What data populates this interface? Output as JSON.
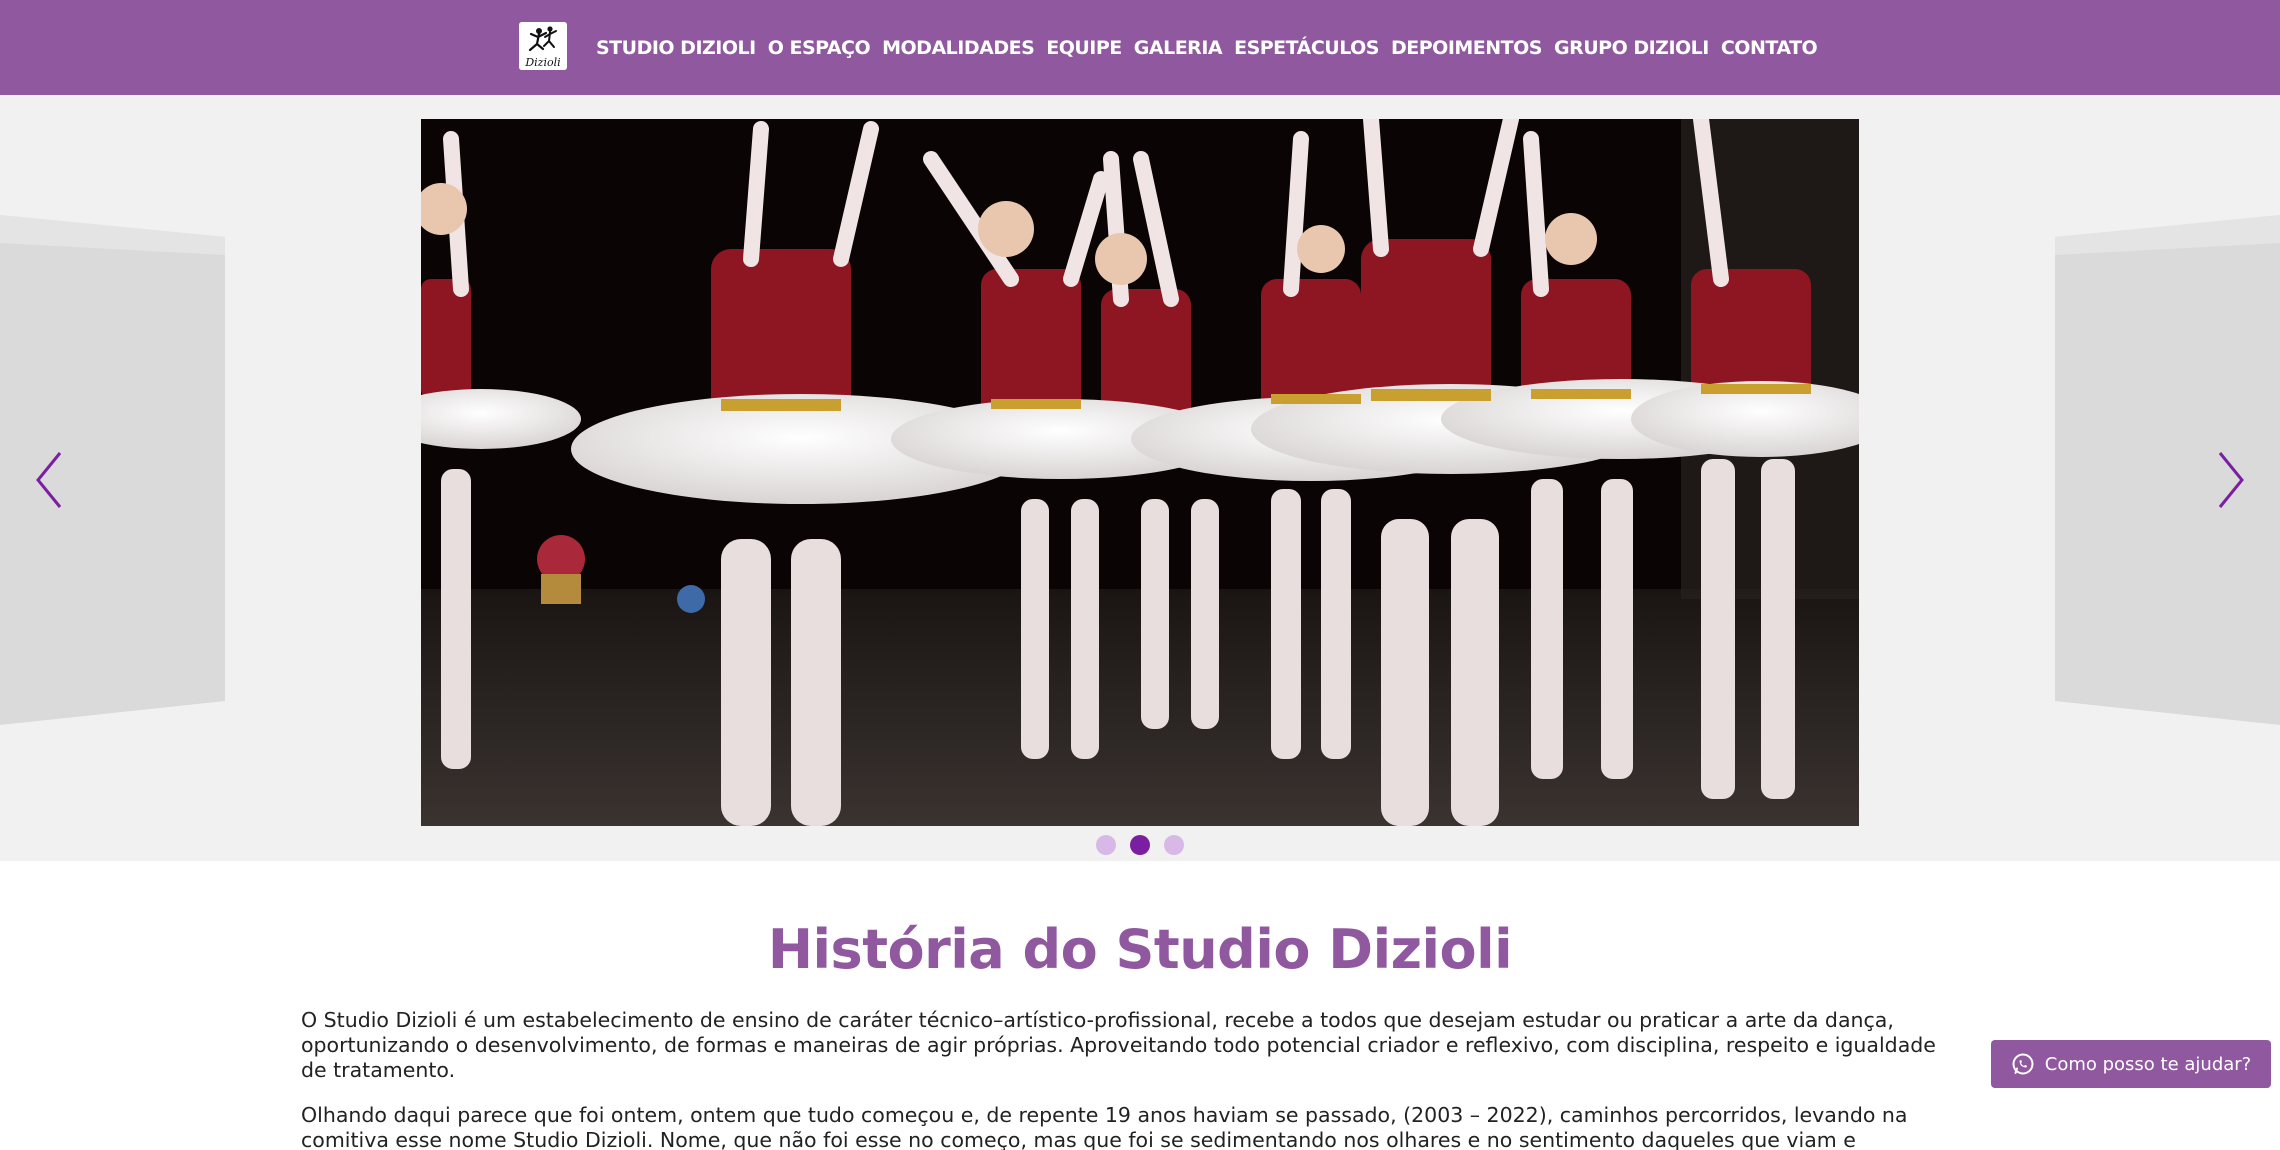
{
  "header": {
    "logo_text": "Dizioli",
    "nav": [
      "STUDIO DIZIOLI",
      "O ESPAÇO",
      "MODALIDADES",
      "EQUIPE",
      "GALERIA",
      "ESPETÁCULOS",
      "DEPOIMENTOS",
      "GRUPO DIZIOLI",
      "CONTATO"
    ]
  },
  "carousel": {
    "slide_count": 3,
    "active_slide": 2,
    "prev_icon": "chevron-left-icon",
    "next_icon": "chevron-right-icon"
  },
  "history": {
    "title": "História do Studio Dizioli",
    "paragraphs": [
      "O Studio Dizioli é um estabelecimento de ensino de caráter técnico–artístico-profissional, recebe a todos que desejam estudar ou praticar a arte da dança, oportunizando o desenvolvimento, de formas e maneiras de agir próprias. Aproveitando todo potencial criador e reflexivo, com disciplina, respeito e igualdade de tratamento.",
      "Olhando daqui parece que foi ontem, ontem que tudo começou e, de repente 19 anos haviam se passado, (2003 – 2022), caminhos percorridos, levando na comitiva esse nome Studio Dizioli. Nome, que não foi esse no começo, mas que foi se sedimentando nos olhares e no sentimento daqueles que viam e"
    ]
  },
  "whatsapp": {
    "label": "Como posso te ajudar?",
    "icon": "whatsapp-icon"
  },
  "colors": {
    "brand": "#8f589f",
    "accent": "#7b1fa2",
    "dot_inactive": "#d8b8e6",
    "carousel_bg": "#f1f1f1"
  }
}
